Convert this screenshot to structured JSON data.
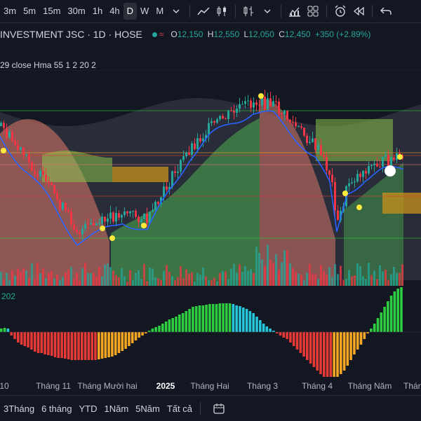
{
  "toolbar": {
    "timeframes": [
      "3m",
      "5m",
      "15m",
      "30m",
      "1h",
      "4h",
      "D",
      "W",
      "M"
    ],
    "active_timeframe": "D",
    "icons": [
      "chevron-down-icon",
      "line-chart-icon",
      "candles-icon",
      "bar-style-icon",
      "chevron-down-icon",
      "compare-icon",
      "layout-icon",
      "alert-icon",
      "replay-icon",
      "undo-icon"
    ]
  },
  "legend": {
    "symbol_title": "INVESTMENT JSC · 1D · HOSE",
    "open_label": "O",
    "open": "12,150",
    "high_label": "H",
    "high": "12,550",
    "low_label": "L",
    "low": "12,050",
    "close_label": "C",
    "close": "12,450",
    "change": "+350 (+2.89%)"
  },
  "indicator_top": "29 close Hma 55 1 2 20 2",
  "indicator_bottom": "202",
  "xaxis": {
    "labels": [
      "10",
      "Tháng 11",
      "Tháng Mười hai",
      "2025",
      "Tháng Hai",
      "Tháng 3",
      "Tháng 4",
      "Tháng Năm",
      "Tháng"
    ]
  },
  "bottom": {
    "ranges": [
      "3Tháng",
      "6 tháng",
      "YTD",
      "1Năm",
      "5Năm",
      "Tất cả"
    ]
  },
  "colors": {
    "up": "#26a69a",
    "down": "#f23645",
    "bg": "#131722",
    "cloud_green": "#4caf50",
    "cloud_red": "#b2665e",
    "cloud_orange": "#c8921a",
    "hist_green": "#2ecc40",
    "hist_cyan": "#26c6da",
    "hist_red": "#e53935",
    "hist_orange": "#f5a623"
  },
  "chart_data": [
    {
      "type": "candlestick",
      "title": "INVESTMENT JSC · 1D · HOSE",
      "x_range": [
        "2024-10",
        "2025-06"
      ],
      "last_bar": {
        "open": 12150,
        "high": 12550,
        "low": 12050,
        "close": 12450,
        "change": 350,
        "change_pct": 2.89
      },
      "overlays": [
        "ichimoku cloud",
        "hma",
        "volume"
      ]
    },
    {
      "type": "bar",
      "title": "oscillator histogram",
      "series": [
        {
          "values": [
            0.05,
            0.06,
            0.05,
            -0.05,
            -0.1,
            -0.15,
            -0.18,
            -0.2,
            -0.22,
            -0.25,
            -0.28,
            -0.3,
            -0.3,
            -0.32,
            -0.33,
            -0.34,
            -0.36,
            -0.37,
            -0.37,
            -0.38,
            -0.39,
            -0.4,
            -0.4,
            -0.4,
            -0.4,
            -0.4,
            -0.4,
            -0.4,
            -0.4,
            -0.39,
            -0.38,
            -0.37,
            -0.36,
            -0.35,
            -0.33,
            -0.3,
            -0.27,
            -0.24,
            -0.2,
            -0.16,
            -0.12,
            -0.08,
            -0.05,
            -0.02,
            0.02,
            0.05,
            0.07,
            0.09,
            0.12,
            0.15,
            0.18,
            0.2,
            0.22,
            0.25,
            0.27,
            0.3,
            0.33,
            0.36,
            0.37,
            0.38,
            0.38,
            0.39,
            0.4,
            0.4,
            0.4,
            0.41,
            0.41,
            0.41,
            0.41,
            0.4,
            0.38,
            0.37,
            0.35,
            0.33,
            0.3,
            0.27,
            0.22,
            0.17,
            0.12,
            0.08,
            0.05,
            0.02,
            -0.02,
            -0.05,
            -0.08,
            -0.1,
            -0.15,
            -0.2,
            -0.25,
            -0.3,
            -0.35,
            -0.4,
            -0.45,
            -0.5,
            -0.55,
            -0.6,
            -0.65,
            -0.7,
            -0.72,
            -0.7,
            -0.65,
            -0.6,
            -0.55,
            -0.48,
            -0.4,
            -0.32,
            -0.25,
            -0.18,
            -0.1,
            -0.02,
            0.05,
            0.12,
            0.2,
            0.28,
            0.36,
            0.44,
            0.52,
            0.58,
            0.62,
            0.65
          ]
        }
      ]
    }
  ]
}
